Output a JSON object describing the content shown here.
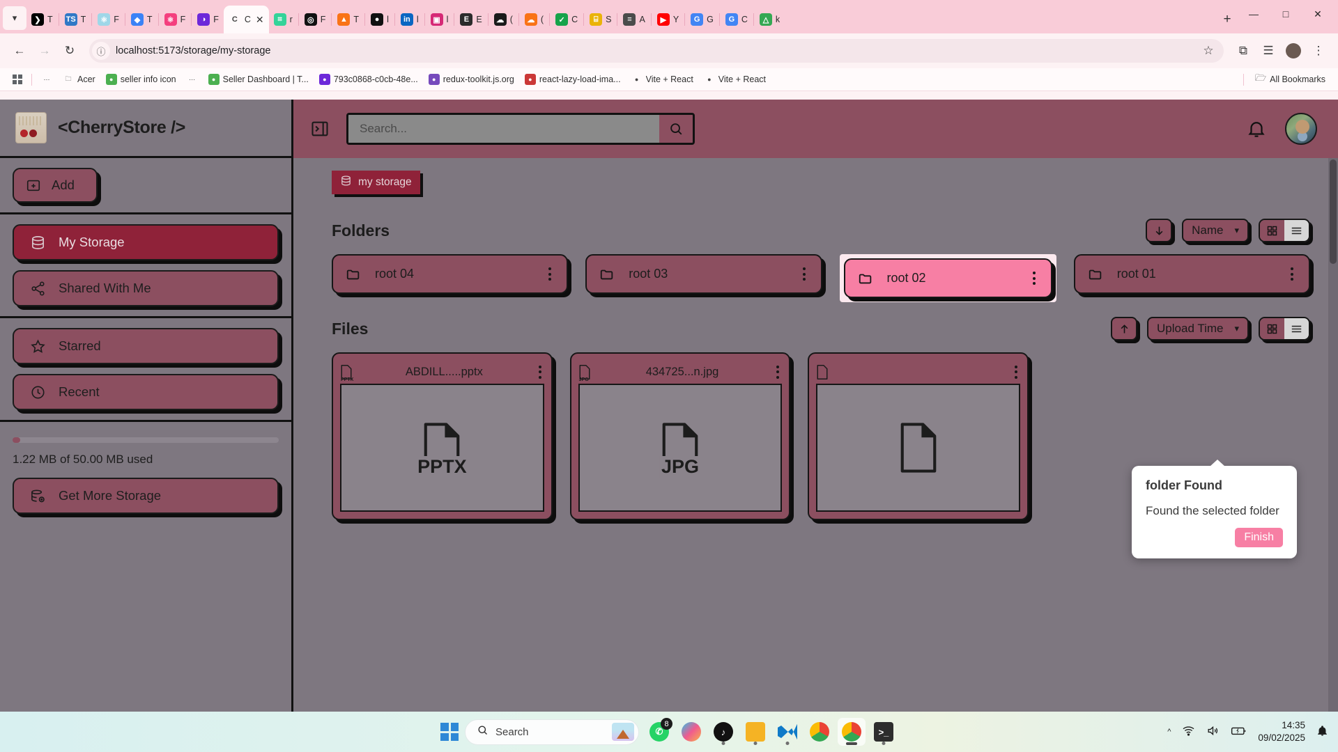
{
  "browser": {
    "tabs": [
      {
        "label": "T",
        "icon": "terminal-icon",
        "color": "#000000",
        "glyph": "❯",
        "active": false
      },
      {
        "label": "T",
        "icon": "typescript-icon",
        "color": "#3178c6",
        "glyph": "TS",
        "active": false
      },
      {
        "label": "F",
        "icon": "react-icon",
        "color": "#9fd7e8",
        "glyph": "⚛",
        "active": false
      },
      {
        "label": "T",
        "icon": "vercel-icon",
        "color": "#3b82f6",
        "glyph": "◆",
        "active": false
      },
      {
        "label": "F",
        "icon": "react-pink-icon",
        "color": "#f43f7e",
        "glyph": "⚛",
        "active": false
      },
      {
        "label": "F",
        "icon": "mongodb-icon",
        "color": "#6d28d9",
        "glyph": "◑",
        "active": false
      },
      {
        "label": "C",
        "icon": "cherrystore-icon",
        "color": "#ffffff",
        "glyph": "C",
        "active": true
      },
      {
        "label": "r",
        "icon": "sheets-icon",
        "color": "#34d399",
        "glyph": "⌗",
        "active": false
      },
      {
        "label": "F",
        "icon": "openai-icon",
        "color": "#111111",
        "glyph": "◎",
        "active": false
      },
      {
        "label": "T",
        "icon": "firebase-icon",
        "color": "#f97316",
        "glyph": "▲",
        "active": false
      },
      {
        "label": "l",
        "icon": "github-icon",
        "color": "#111111",
        "glyph": "●",
        "active": false
      },
      {
        "label": "l",
        "icon": "linkedin-icon",
        "color": "#0a66c2",
        "glyph": "in",
        "active": false
      },
      {
        "label": "l",
        "icon": "instagram-icon",
        "color": "#d62976",
        "glyph": "▣",
        "active": false
      },
      {
        "label": "E",
        "icon": "email-icon",
        "color": "#2b2b2b",
        "glyph": "E",
        "active": false
      },
      {
        "label": "(",
        "icon": "cloud-icon",
        "color": "#1a1a1a",
        "glyph": "☁",
        "active": false
      },
      {
        "label": "(",
        "icon": "cloudinary-icon",
        "color": "#f97316",
        "glyph": "☁",
        "active": false
      },
      {
        "label": "C",
        "icon": "vercel-check-icon",
        "color": "#16a34a",
        "glyph": "✓",
        "active": false
      },
      {
        "label": "S",
        "icon": "slides-icon",
        "color": "#eab308",
        "glyph": "⌸",
        "active": false
      },
      {
        "label": "A",
        "icon": "stackoverflow-icon",
        "color": "#4b4b4b",
        "glyph": "≡",
        "active": false
      },
      {
        "label": "Y",
        "icon": "youtube-icon",
        "color": "#ff0000",
        "glyph": "▶",
        "active": false
      },
      {
        "label": "G",
        "icon": "google-icon",
        "color": "#4285f4",
        "glyph": "G",
        "active": false
      },
      {
        "label": "C",
        "icon": "google-search-icon",
        "color": "#4285f4",
        "glyph": "G",
        "active": false
      },
      {
        "label": "k",
        "icon": "drive-icon",
        "color": "#34a853",
        "glyph": "△",
        "active": false
      }
    ],
    "new_tab_label": "+",
    "window_controls": {
      "minimize": "—",
      "maximize": "□",
      "close": "✕"
    },
    "nav": {
      "back": "←",
      "forward": "→",
      "reload": "↻",
      "info": "ⓘ",
      "url": "localhost:5173/storage/my-storage",
      "star": "☆",
      "extensions": "⧉",
      "downloads": "☰",
      "profile": "●",
      "menu": "⋮"
    },
    "bookmarks": {
      "apps_icon": "apps-grid-icon",
      "items": [
        {
          "label": "",
          "icon": "dots-icon",
          "color": "#ffffff"
        },
        {
          "label": "Acer",
          "icon": "folder-icon",
          "color": "#ffffff"
        },
        {
          "label": "seller info icon",
          "icon": "frog-icon",
          "color": "#4caf50"
        },
        {
          "label": "",
          "icon": "dots-icon",
          "color": "#ffffff"
        },
        {
          "label": "Seller Dashboard | T...",
          "icon": "frog-icon",
          "color": "#4caf50"
        },
        {
          "label": "793c0868-c0cb-48e...",
          "icon": "mongodb-icon",
          "color": "#6d28d9"
        },
        {
          "label": "redux-toolkit.js.org",
          "icon": "redux-icon",
          "color": "#764abc"
        },
        {
          "label": "react-lazy-load-ima...",
          "icon": "npm-icon",
          "color": "#cb3837"
        },
        {
          "label": "Vite + React",
          "icon": "vite-icon",
          "color": "#ffffff"
        },
        {
          "label": "Vite + React",
          "icon": "vite-icon",
          "color": "#ffffff"
        }
      ],
      "all_bookmarks": "All Bookmarks",
      "all_bookmarks_icon": "folder-icon"
    }
  },
  "app": {
    "brand": {
      "title": "<CherryStore />",
      "logo_icon": "cherry-logo-icon"
    },
    "sidebar": {
      "add_button": {
        "label": "Add",
        "icon": "folder-plus-icon"
      },
      "nav_items": [
        {
          "label": "My Storage",
          "icon": "database-icon",
          "active": true
        },
        {
          "label": "Shared With Me",
          "icon": "share-icon",
          "active": false
        }
      ],
      "secondary_items": [
        {
          "label": "Starred",
          "icon": "star-icon",
          "active": false
        },
        {
          "label": "Recent",
          "icon": "clock-icon",
          "active": false
        }
      ],
      "storage": {
        "used_text": "1.22 MB of 50.00 MB used",
        "percent": 2.44,
        "upgrade_label": "Get More Storage",
        "upgrade_icon": "database-plus-icon"
      }
    },
    "topbar": {
      "collapse_icon": "panel-toggle-icon",
      "search_placeholder": "Search...",
      "search_value": "",
      "search_icon": "search-icon",
      "bell_icon": "bell-icon",
      "avatar_name": "user-avatar"
    },
    "breadcrumb": {
      "label": "my storage",
      "icon": "database-icon"
    },
    "folders_section": {
      "title": "Folders",
      "sort_direction_icon": "arrow-down-icon",
      "sort_by": "Name",
      "chevron": "▾",
      "view_grid_icon": "grid-view-icon",
      "view_list_icon": "list-view-icon",
      "items": [
        {
          "name": "root 04",
          "icon": "folder-icon",
          "selected": false
        },
        {
          "name": "root 03",
          "icon": "folder-icon",
          "selected": false
        },
        {
          "name": "root 02",
          "icon": "folder-icon",
          "selected": true
        },
        {
          "name": "root 01",
          "icon": "folder-icon",
          "selected": false
        }
      ]
    },
    "files_section": {
      "title": "Files",
      "sort_direction_icon": "arrow-up-icon",
      "sort_by": "Upload Time",
      "chevron": "▾",
      "view_grid_icon": "grid-view-icon",
      "view_list_icon": "list-view-icon",
      "items": [
        {
          "name": "ABDILL.....pptx",
          "ext": "PPTX",
          "icon": "file-pptx-icon"
        },
        {
          "name": "434725...n.jpg",
          "ext": "JPG",
          "icon": "file-jpg-icon"
        },
        {
          "name": "",
          "ext": "",
          "icon": "file-generic-icon"
        }
      ]
    },
    "popover": {
      "title": "folder Found",
      "body": "Found the selected folder",
      "button": "Finish"
    },
    "colors": {
      "accent": "#8f2239",
      "surface": "#8c4f60",
      "background": "#7e7780",
      "highlight": "#f77fa4",
      "outline": "#161616"
    }
  },
  "taskbar": {
    "start_icon": "windows-logo-icon",
    "search_placeholder": "Search",
    "search_icon": "search-icon",
    "apps": [
      {
        "name": "whatsapp-icon",
        "badge": "8",
        "running": false,
        "active": false
      },
      {
        "name": "copilot-icon",
        "badge": "",
        "running": false,
        "active": false
      },
      {
        "name": "tiktok-icon",
        "badge": "",
        "running": true,
        "active": false
      },
      {
        "name": "file-explorer-icon",
        "badge": "",
        "running": true,
        "active": false
      },
      {
        "name": "vscode-icon",
        "badge": "",
        "running": true,
        "active": false
      },
      {
        "name": "chrome-icon",
        "badge": "",
        "running": false,
        "active": false
      },
      {
        "name": "chrome-active-icon",
        "badge": "",
        "running": true,
        "active": true
      },
      {
        "name": "terminal-icon",
        "badge": "",
        "running": true,
        "active": false
      }
    ],
    "tray": {
      "chevron": "▲",
      "wifi_icon": "wifi-icon",
      "volume_icon": "volume-icon",
      "battery_icon": "battery-icon",
      "time": "14:35",
      "date": "09/02/2025",
      "notification_icon": "bell-icon"
    }
  }
}
